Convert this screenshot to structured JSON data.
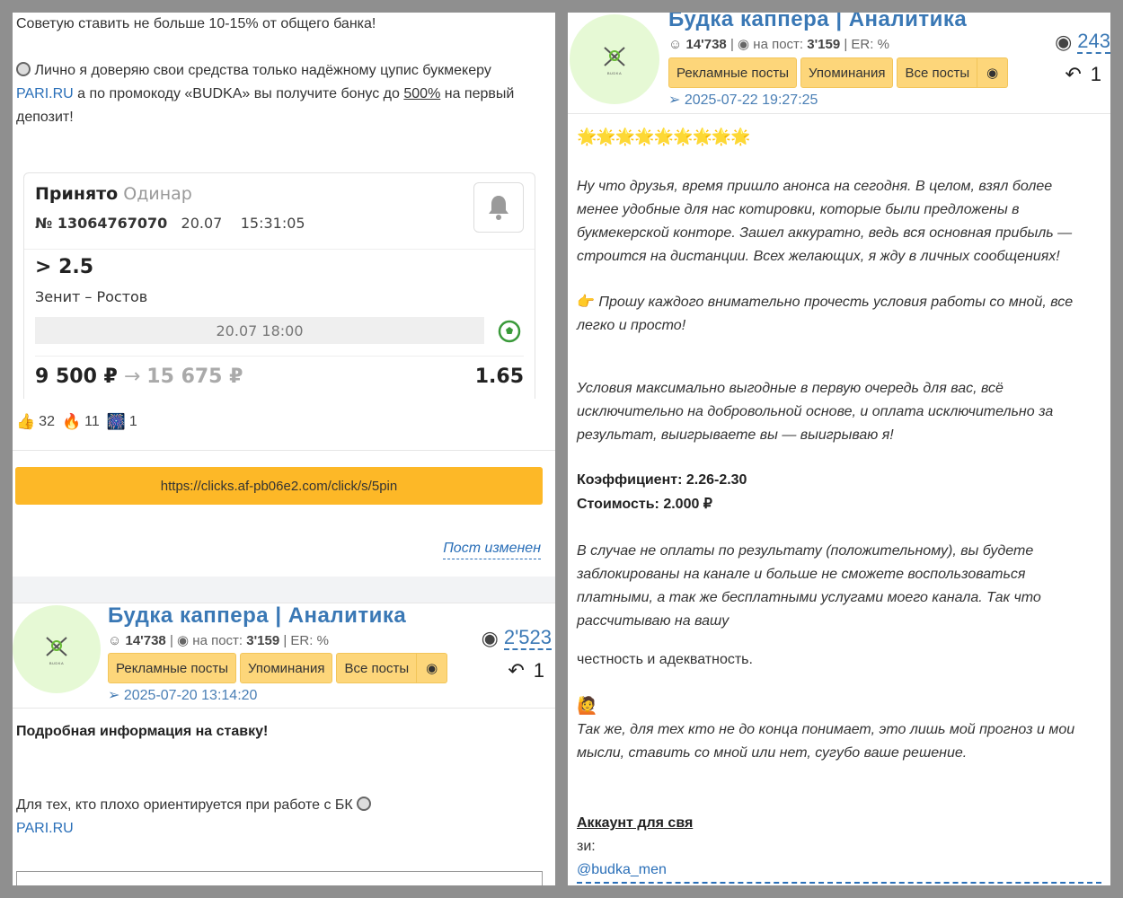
{
  "left": {
    "intro": "Советую ставить не больше 10-15% от общего банка!",
    "trust_line_1": "Лично я доверяю свои средства только надёжному цупис букмекеру",
    "trust_link": "PARI.RU",
    "trust_mid": "а по промокоду «BUDKA» вы получите бонус до",
    "trust_bonus": "500%",
    "trust_end": "на первый",
    "trust_tail": "депозит!",
    "bet": {
      "status": "Принято",
      "type": "Одинар",
      "number": "№ 13064767070",
      "date": "20.07",
      "time": "15:31:05",
      "outcome": "> 2.5",
      "match": "Зенит – Ростов",
      "kickoff": "20.07 18:00",
      "stake": "9 500 ₽",
      "arrow": "→",
      "payout": "15 675 ₽",
      "coef": "1.65"
    },
    "reactions": [
      {
        "emoji": "👍",
        "count": "32"
      },
      {
        "emoji": "🔥",
        "count": "11"
      },
      {
        "emoji": "🎆",
        "count": "1"
      }
    ],
    "link_button": "https://clicks.af-pb06e2.com/click/s/5pin",
    "edited": "Пост изменен",
    "post2": {
      "title": "Будка каппера | Аналитика",
      "subs": "14'738",
      "per_post_label": "на пост:",
      "per_post": "3'159",
      "er": "| ER: %",
      "btn_ads": "Рекламные посты",
      "btn_mentions": "Упоминания",
      "btn_all": "Все посты",
      "date": "2025-07-20 13:14:20",
      "views": "2'523",
      "forwards": "1",
      "headline": "Подробная информация на ставку!",
      "bk_text": "Для тех, кто плохо ориентируется при работе с БК",
      "bk_link": "PARI.RU"
    }
  },
  "right": {
    "title": "Будка каппера | Аналитика",
    "subs": "14'738",
    "per_post_label": "на пост:",
    "per_post": "3'159",
    "er": "| ER: %",
    "btn_ads": "Рекламные посты",
    "btn_mentions": "Упоминания",
    "btn_all": "Все посты",
    "date": "2025-07-22 19:27:25",
    "views": "243",
    "forwards": "1",
    "stars": "🌟🌟🌟🌟🌟🌟🌟🌟🌟",
    "p1": "Ну что друзья, время пришло анонса на сегодня. В целом, взял более менее удобные для нас котировки, которые были предложены в букмекерской конторе. Зашел аккуратно, ведь вся основная прибыль — строится на дистанции. Всех желающих, я жду в личных сообщениях!",
    "p2": "Прошу каждого внимательно прочесть условия работы со мной, все легко и просто!",
    "p3": "Условия максимально выгодные в первую очередь для вас, всё исключительно на добровольной основе, и оплата исключительно за результат, выигрываете вы — выигрываю я!",
    "coef": "Коэффициент: 2.26-2.30",
    "price": "Стоимость: 2.000 ₽",
    "p4": "В случае не оплаты по результату (положительному), вы будете заблокированы на канале и больше не сможете воспользоваться платными, а так же бесплатными услугами моего канала. Так что рассчитываю на вашу",
    "p5": "честность и адекватность.",
    "p6": "Так же, для тех кто не до конца понимает, это лишь мой прогноз и мои мысли, ставить со мной или нет, сугубо ваше решение.",
    "account_label": "Аккаунт для свя",
    "account_label2": "зи:",
    "account": "@budka_men"
  }
}
